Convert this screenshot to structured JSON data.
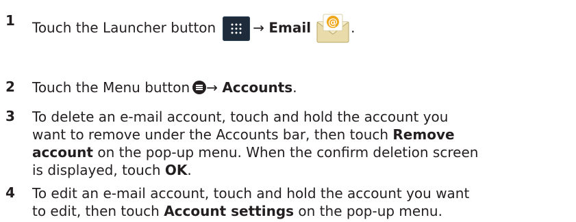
{
  "steps": [
    {
      "number": "1",
      "text_a": "Touch the Launcher button",
      "arrow": "→",
      "bold_a": "Email",
      "end": ".",
      "icons": [
        "launcher-icon",
        "email-icon"
      ]
    },
    {
      "number": "2",
      "text_a": "Touch the Menu button",
      "arrow": "→",
      "bold_a": "Accounts",
      "end": ".",
      "icons": [
        "menu-icon"
      ]
    },
    {
      "number": "3",
      "line1": "To delete an e-mail account, touch and hold the account you",
      "line2_a": "want to remove under the Accounts bar, then touch",
      "line2_bold": "Remove",
      "line3_bold": "account",
      "line3_a": "on the pop-up menu. When the confirm deletion screen",
      "line4_a": "is displayed, touch",
      "line4_bold": "OK",
      "line4_end": "."
    },
    {
      "number": "4",
      "line1": "To edit an e-mail account, touch and hold the account you want",
      "line2_a": "to edit, then touch",
      "line2_bold": "Account settings",
      "line2_b": "on the pop-up menu."
    }
  ],
  "colors": {
    "text": "#231f20",
    "launcher_bg": "#1d2b3a",
    "mail_envelope": "#f2e6b8",
    "mail_at": "#f0a81a"
  }
}
